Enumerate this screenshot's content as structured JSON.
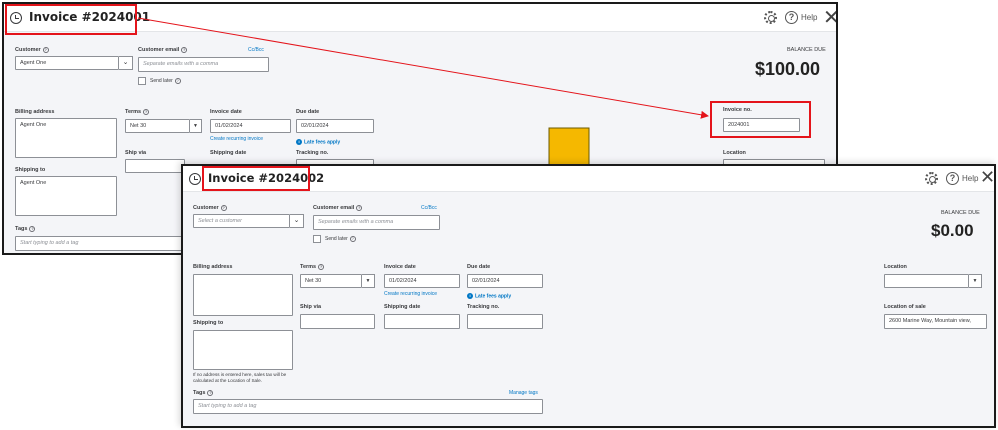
{
  "panel1": {
    "title": "Invoice #2024001",
    "help_label": "Help",
    "customer": {
      "label": "Customer",
      "value": "Agent One"
    },
    "customer_email": {
      "label": "Customer email",
      "placeholder": "Separate emails with a comma",
      "cc_bcc": "Cc/Bcc"
    },
    "send_later": "Send later",
    "balance_due": {
      "label": "BALANCE DUE",
      "amount": "$100.00"
    },
    "billing_address": {
      "label": "Billing address",
      "value": "Agent One"
    },
    "terms": {
      "label": "Terms",
      "value": "Net 30"
    },
    "invoice_date": {
      "label": "Invoice date",
      "value": "01/02/2024"
    },
    "create_recurring": "Create recurring invoice",
    "due_date": {
      "label": "Due date",
      "value": "02/01/2024"
    },
    "late_fees": "Late fees apply",
    "invoice_no": {
      "label": "Invoice no.",
      "value": "2024001"
    },
    "ship_via": "Ship via",
    "shipping_date": "Shipping date",
    "tracking_no": "Tracking no.",
    "location": "Location",
    "shipping_to": {
      "label": "Shipping to",
      "value": "Agent One"
    },
    "tags": {
      "label": "Tags",
      "placeholder": "Start typing to add a tag"
    }
  },
  "panel2": {
    "title": "Invoice #2024002",
    "help_label": "Help",
    "customer": {
      "label": "Customer",
      "placeholder": "Select a customer"
    },
    "customer_email": {
      "label": "Customer email",
      "placeholder": "Separate emails with a comma",
      "cc_bcc": "Cc/Bcc"
    },
    "send_later": "Send later",
    "balance_due": {
      "label": "BALANCE DUE",
      "amount": "$0.00"
    },
    "billing_address": {
      "label": "Billing address"
    },
    "terms": {
      "label": "Terms",
      "value": "Net 30"
    },
    "invoice_date": {
      "label": "Invoice date",
      "value": "01/02/2024"
    },
    "create_recurring": "Create recurring invoice",
    "due_date": {
      "label": "Due date",
      "value": "02/01/2024"
    },
    "late_fees": "Late fees apply",
    "location": {
      "label": "Location"
    },
    "ship_via": "Ship via",
    "shipping_date": "Shipping date",
    "tracking_no": "Tracking no.",
    "location_of_sale": {
      "label": "Location of sale",
      "value": "2600 Marine Way, Mountain view,"
    },
    "shipping_to": {
      "label": "Shipping to"
    },
    "address_note": "If no address is entered here, sales tax will be calculated at the Location of Sale.",
    "tags": {
      "label": "Tags",
      "placeholder": "Start typing to add a tag",
      "manage": "Manage tags"
    }
  },
  "colors": {
    "highlight": "#e4141b",
    "arrow": "#f5b800",
    "link": "#0077c5",
    "form_background": "#f4f5f8"
  },
  "icons": [
    "history-icon",
    "gear-icon",
    "help-icon",
    "close-icon",
    "chevron-down-icon",
    "question-icon",
    "info-icon"
  ]
}
